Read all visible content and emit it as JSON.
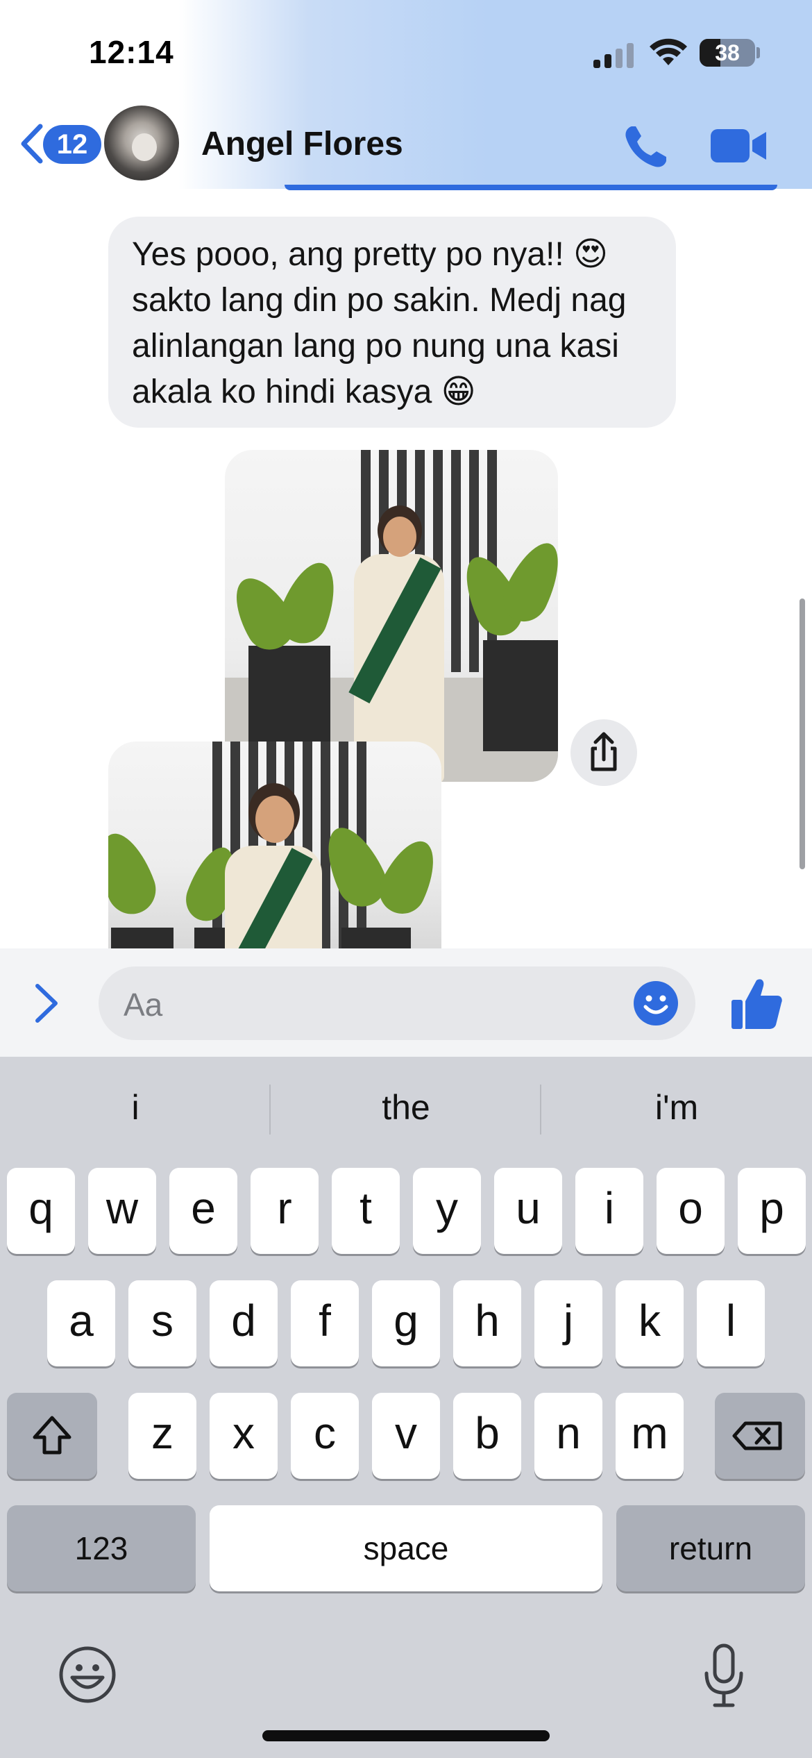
{
  "status_bar": {
    "time": "12:14",
    "battery_level": "38",
    "battery_fraction": 0.38
  },
  "header": {
    "back_count": "12",
    "contact_name": "Angel Flores",
    "call_icon": "phone-icon",
    "video_icon": "video-camera-icon",
    "accent_color": "#2f6bde"
  },
  "messages": [
    {
      "type": "text",
      "text": "Yes pooo, ang pretty po nya!! 😍 sakto lang din po sakin. Medj nag alinlangan lang po nung una kasi akala ko hindi kasya 😁"
    },
    {
      "type": "photo",
      "subject": "photo"
    },
    {
      "type": "photo",
      "subject": "photo"
    }
  ],
  "composer": {
    "placeholder": "Aa",
    "expand_icon": "chevron-right-icon",
    "emoji_icon": "smiley-icon",
    "like_icon": "thumbs-up-icon"
  },
  "keyboard": {
    "suggestions": [
      "i",
      "the",
      "i'm"
    ],
    "row1": [
      "q",
      "w",
      "e",
      "r",
      "t",
      "y",
      "u",
      "i",
      "o",
      "p"
    ],
    "row2": [
      "a",
      "s",
      "d",
      "f",
      "g",
      "h",
      "j",
      "k",
      "l"
    ],
    "row3": [
      "z",
      "x",
      "c",
      "v",
      "b",
      "n",
      "m"
    ],
    "numbers_label": "123",
    "space_label": "space",
    "return_label": "return",
    "shift_icon": "shift-icon",
    "delete_icon": "delete-icon",
    "emoji_icon": "emoji-icon",
    "mic_icon": "microphone-icon"
  }
}
